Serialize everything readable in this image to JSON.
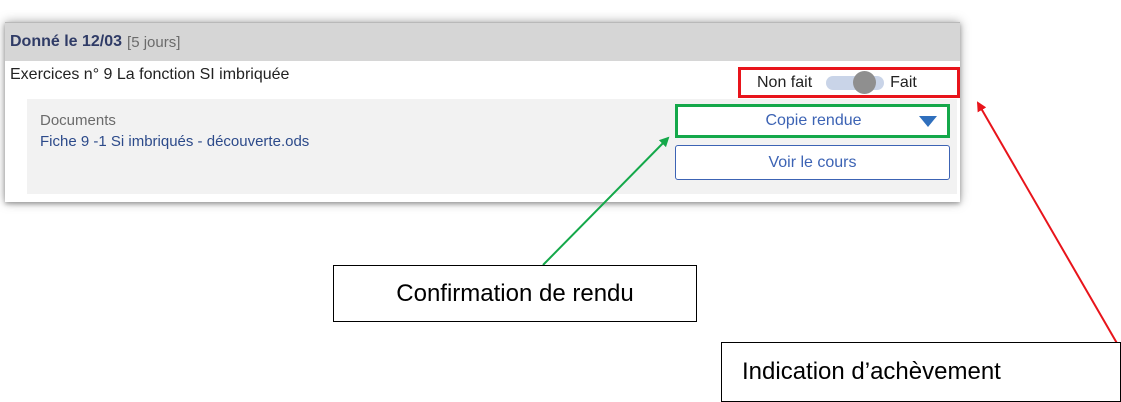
{
  "card": {
    "date_label": "Donné le 12/03",
    "duration_label": "[5 jours]",
    "exercise_title": "Exercices n° 9 La fonction SI imbriquée",
    "documents_heading": "Documents",
    "document_link": "Fiche 9 -1 Si imbriqués - découverte.ods"
  },
  "status_toggle": {
    "off_label": "Non fait",
    "on_label": "Fait",
    "state": "on"
  },
  "submission_dropdown": {
    "selected": "Copie rendue"
  },
  "course_button": {
    "label": "Voir le cours"
  },
  "annotations": {
    "submission_callout": "Confirmation de rendu",
    "completion_callout": "Indication d’achèvement",
    "submission_color": "#14a84a",
    "completion_color": "#e8141b"
  }
}
